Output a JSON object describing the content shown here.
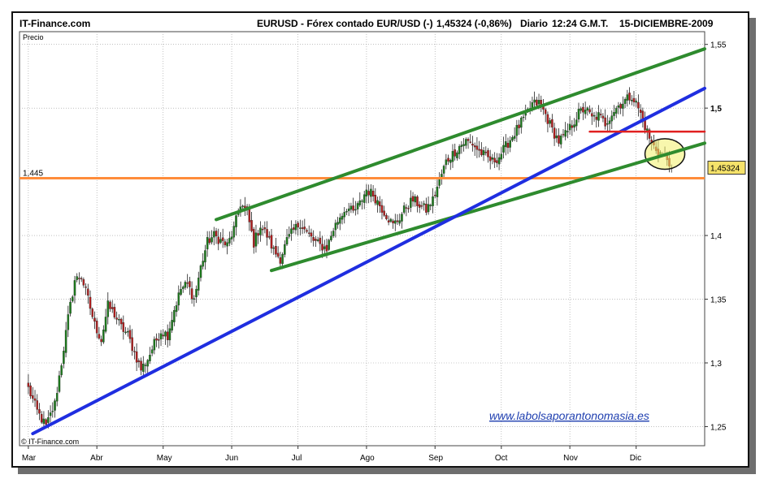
{
  "header": {
    "site": "IT-Finance.com",
    "instrument": "EURUSD - Fórex contado EUR/USD (-)",
    "quote": "1,45324 (-0,86%)",
    "period": "Diario",
    "time": "12:24",
    "tz": "G.M.T.",
    "date": "15-DICIEMBRE-2009"
  },
  "watermark": "www.labolsaporantonomasia.es",
  "copyright": "© IT-Finance.com",
  "colors": {
    "up": "#1c7a1c",
    "down": "#b01e1e",
    "channel": "#2e8b2e",
    "trend": "#1f2ee0",
    "support": "#ff8c3a",
    "resistance": "#e02020",
    "highlight": "#f3f06a",
    "last_price_box": "#f5e26a"
  },
  "chart_data": {
    "type": "candlestick",
    "ylabel": "Precio",
    "ylim": [
      1.235,
      1.56
    ],
    "y_ticks": [
      {
        "value": 1.25,
        "label": "1,25"
      },
      {
        "value": 1.3,
        "label": "1,3"
      },
      {
        "value": 1.35,
        "label": "1,35"
      },
      {
        "value": 1.4,
        "label": "1,4"
      },
      {
        "value": 1.5,
        "label": "1,5"
      },
      {
        "value": 1.55,
        "label": "1,55"
      }
    ],
    "x_months": [
      {
        "label": "Mar",
        "day": 0
      },
      {
        "label": "Abr",
        "day": 31
      },
      {
        "label": "May",
        "day": 61
      },
      {
        "label": "Jun",
        "day": 92
      },
      {
        "label": "Jul",
        "day": 122
      },
      {
        "label": "Ago",
        "day": 153
      },
      {
        "label": "Sep",
        "day": 184
      },
      {
        "label": "Oct",
        "day": 214
      },
      {
        "label": "Nov",
        "day": 245
      },
      {
        "label": "Dic",
        "day": 275
      }
    ],
    "x_range_days": [
      -4,
      306
    ],
    "last_price": {
      "value": 1.45324,
      "label": "1,45324"
    },
    "support_level": {
      "value": 1.445,
      "label": "1,445"
    },
    "trend_lines": [
      {
        "name": "channel-upper",
        "color": "channel",
        "from": [
          85,
          1.4125
        ],
        "to": [
          306,
          1.5465
        ]
      },
      {
        "name": "channel-lower",
        "color": "channel",
        "from": [
          110,
          1.3725
        ],
        "to": [
          306,
          1.4725
        ]
      },
      {
        "name": "trend-support",
        "color": "trend",
        "from": [
          2,
          1.2445
        ],
        "to": [
          306,
          1.5155
        ]
      },
      {
        "name": "resistance",
        "color": "resistance",
        "from": [
          254,
          1.4815
        ],
        "to": [
          306,
          1.4815
        ]
      }
    ],
    "highlight_ellipse": {
      "center": [
        288,
        1.464
      ],
      "rx_days": 9,
      "ry_value": 0.012
    },
    "anchors": [
      [
        0,
        1.28
      ],
      [
        4,
        1.262
      ],
      [
        8,
        1.25
      ],
      [
        12,
        1.268
      ],
      [
        15,
        1.3
      ],
      [
        18,
        1.335
      ],
      [
        21,
        1.365
      ],
      [
        24,
        1.368
      ],
      [
        27,
        1.35
      ],
      [
        30,
        1.33
      ],
      [
        33,
        1.318
      ],
      [
        36,
        1.345
      ],
      [
        39,
        1.338
      ],
      [
        42,
        1.328
      ],
      [
        45,
        1.322
      ],
      [
        48,
        1.308
      ],
      [
        51,
        1.295
      ],
      [
        54,
        1.303
      ],
      [
        57,
        1.315
      ],
      [
        60,
        1.325
      ],
      [
        63,
        1.322
      ],
      [
        66,
        1.342
      ],
      [
        69,
        1.358
      ],
      [
        72,
        1.362
      ],
      [
        75,
        1.35
      ],
      [
        78,
        1.375
      ],
      [
        81,
        1.395
      ],
      [
        84,
        1.4
      ],
      [
        87,
        1.396
      ],
      [
        90,
        1.392
      ],
      [
        93,
        1.405
      ],
      [
        96,
        1.425
      ],
      [
        99,
        1.418
      ],
      [
        102,
        1.394
      ],
      [
        105,
        1.408
      ],
      [
        108,
        1.4
      ],
      [
        111,
        1.388
      ],
      [
        114,
        1.382
      ],
      [
        117,
        1.396
      ],
      [
        120,
        1.404
      ],
      [
        123,
        1.41
      ],
      [
        126,
        1.402
      ],
      [
        129,
        1.396
      ],
      [
        132,
        1.392
      ],
      [
        135,
        1.39
      ],
      [
        138,
        1.405
      ],
      [
        141,
        1.415
      ],
      [
        144,
        1.422
      ],
      [
        147,
        1.418
      ],
      [
        150,
        1.425
      ],
      [
        153,
        1.436
      ],
      [
        156,
        1.432
      ],
      [
        159,
        1.424
      ],
      [
        162,
        1.416
      ],
      [
        165,
        1.408
      ],
      [
        168,
        1.414
      ],
      [
        171,
        1.423
      ],
      [
        174,
        1.428
      ],
      [
        177,
        1.424
      ],
      [
        180,
        1.42
      ],
      [
        183,
        1.428
      ],
      [
        186,
        1.443
      ],
      [
        189,
        1.458
      ],
      [
        192,
        1.464
      ],
      [
        195,
        1.47
      ],
      [
        198,
        1.474
      ],
      [
        201,
        1.472
      ],
      [
        204,
        1.466
      ],
      [
        207,
        1.462
      ],
      [
        210,
        1.458
      ],
      [
        213,
        1.462
      ],
      [
        216,
        1.47
      ],
      [
        219,
        1.478
      ],
      [
        222,
        1.486
      ],
      [
        225,
        1.494
      ],
      [
        228,
        1.503
      ],
      [
        231,
        1.504
      ],
      [
        234,
        1.495
      ],
      [
        237,
        1.483
      ],
      [
        240,
        1.474
      ],
      [
        243,
        1.479
      ],
      [
        246,
        1.487
      ],
      [
        249,
        1.496
      ],
      [
        252,
        1.5
      ],
      [
        255,
        1.492
      ],
      [
        258,
        1.494
      ],
      [
        261,
        1.488
      ],
      [
        264,
        1.496
      ],
      [
        267,
        1.502
      ],
      [
        270,
        1.506
      ],
      [
        273,
        1.51
      ],
      [
        276,
        1.5
      ],
      [
        279,
        1.486
      ],
      [
        282,
        1.472
      ],
      [
        285,
        1.466
      ],
      [
        288,
        1.462
      ],
      [
        291,
        1.456
      ]
    ]
  }
}
